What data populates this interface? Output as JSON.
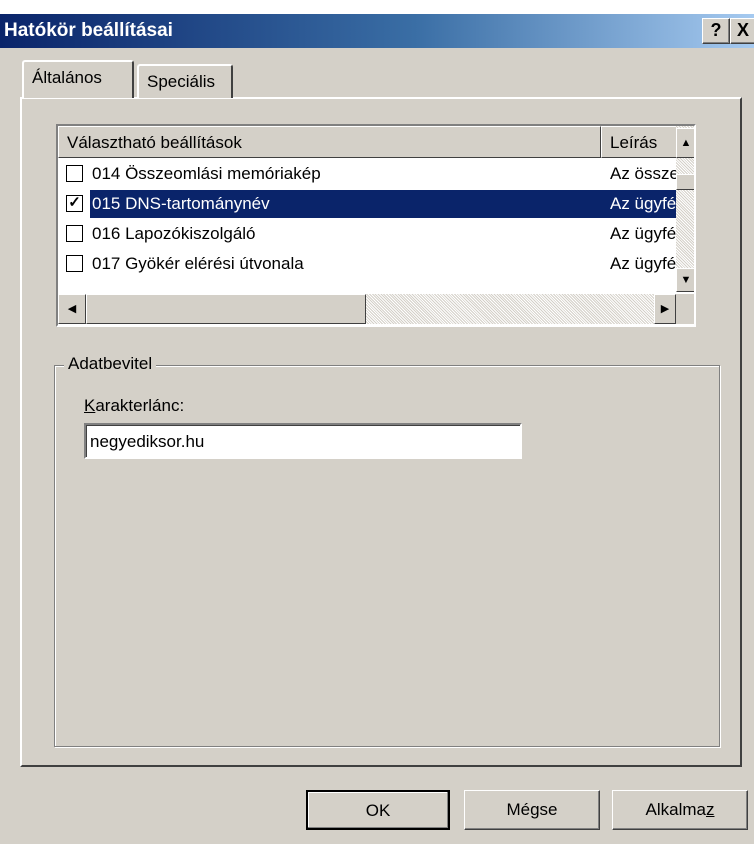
{
  "window": {
    "title": "Hatókör beállításai",
    "help_label": "?",
    "close_label": "X"
  },
  "tabs": [
    {
      "label": "Általános",
      "selected": true
    },
    {
      "label": "Speciális",
      "selected": false
    }
  ],
  "options_list": {
    "columns": [
      "Választható beállítások",
      "Leírás"
    ],
    "rows": [
      {
        "checked": false,
        "name": "014 Összeomlási memóriakép",
        "desc": "Az össze",
        "selected": false
      },
      {
        "checked": true,
        "name": "015 DNS-tartománynév",
        "desc": "Az ügyfé",
        "selected": true
      },
      {
        "checked": false,
        "name": "016 Lapozókiszolgáló",
        "desc": "Az ügyfé",
        "selected": false
      },
      {
        "checked": false,
        "name": "017 Gyökér elérési útvonala",
        "desc": "Az ügyfé",
        "selected": false
      }
    ],
    "check_mark": "✓"
  },
  "data_entry": {
    "group_title": "Adatbevitel",
    "string_label_accel": "K",
    "string_label_rest": "arakterlánc:",
    "string_value": "negyediksor.hu"
  },
  "buttons": {
    "ok": "OK",
    "cancel": "Mégse",
    "apply_prefix": "Alkalma",
    "apply_accel": "z"
  },
  "colors": {
    "title_bar": "#0a246a",
    "selection": "#0a246a",
    "face": "#d4d0c8"
  }
}
